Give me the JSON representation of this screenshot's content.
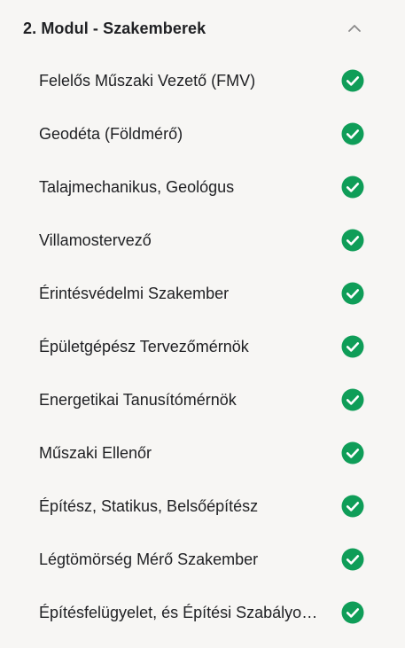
{
  "module": {
    "title": "2. Modul - Szakemberek",
    "expanded": true,
    "accent_color": "#0f9d58",
    "items": [
      {
        "label": "Felelős Műszaki Vezető (FMV)",
        "status": "completed",
        "icon": "check-circle-icon"
      },
      {
        "label": "Geodéta (Földmérő)",
        "status": "completed",
        "icon": "check-circle-icon"
      },
      {
        "label": "Talajmechanikus, Geológus",
        "status": "completed",
        "icon": "check-circle-icon"
      },
      {
        "label": "Villamostervező",
        "status": "completed",
        "icon": "check-circle-icon"
      },
      {
        "label": "Érintésvédelmi Szakember",
        "status": "completed",
        "icon": "check-circle-icon"
      },
      {
        "label": "Épületgépész Tervezőmérnök",
        "status": "completed",
        "icon": "check-circle-icon"
      },
      {
        "label": "Energetikai Tanusítómérnök",
        "status": "completed",
        "icon": "check-circle-icon"
      },
      {
        "label": "Műszaki Ellenőr",
        "status": "completed",
        "icon": "check-circle-icon"
      },
      {
        "label": "Építész, Statikus, Belsőépítész",
        "status": "completed",
        "icon": "check-circle-icon"
      },
      {
        "label": "Légtömörség Mérő Szakember",
        "status": "completed",
        "icon": "check-circle-icon"
      },
      {
        "label": "Építésfelügyelet, és Építési Szabályozás",
        "status": "completed",
        "icon": "check-circle-icon"
      }
    ]
  }
}
